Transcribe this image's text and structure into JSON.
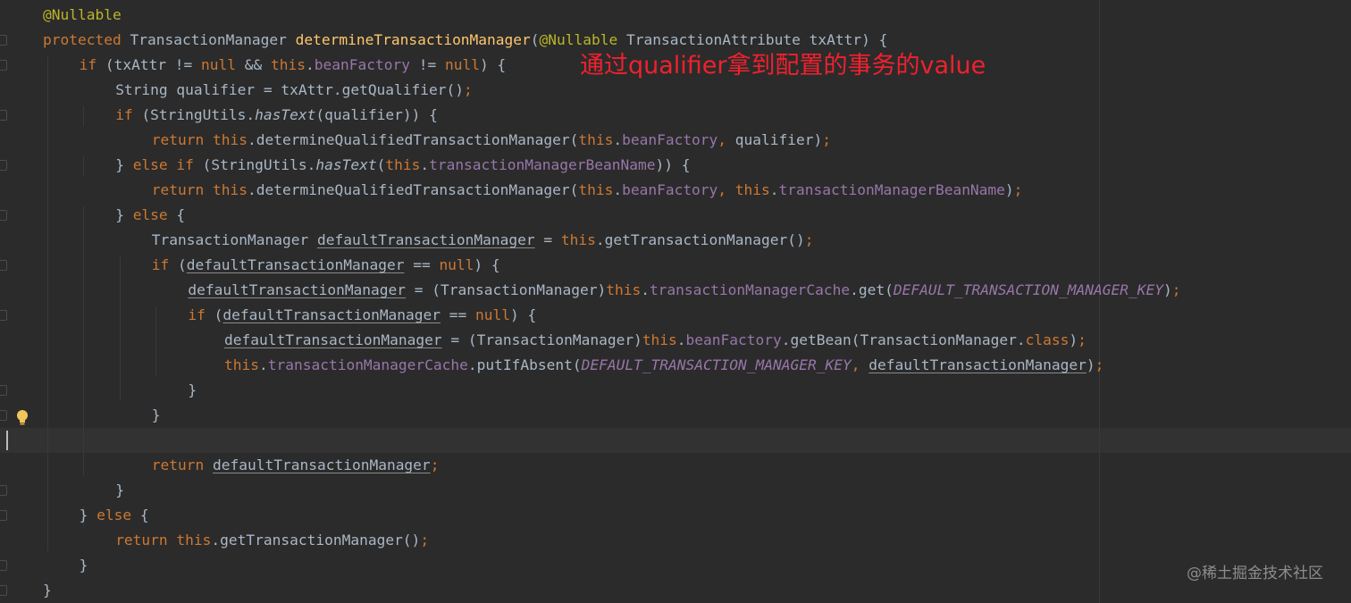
{
  "annotation": "通过qualifier拿到配置的事务的value",
  "watermark": "@稀土掘金技术社区",
  "icons": {
    "intention_bulb": "lightbulb-icon",
    "fold_marker": "fold-marker-icon"
  },
  "colors": {
    "background": "#2b2b2b",
    "keyword": "#cc7832",
    "annotation_tag": "#bbb529",
    "method_declaration": "#ffc66d",
    "field": "#9876aa",
    "default_text": "#a9b7c6",
    "callout": "#f0212e"
  },
  "code": {
    "lines": [
      {
        "indent": 0,
        "tokens": [
          {
            "t": "@Nullable",
            "c": "ann"
          }
        ]
      },
      {
        "indent": 0,
        "tokens": [
          {
            "t": "protected ",
            "c": "kw"
          },
          {
            "t": "TransactionManager "
          },
          {
            "t": "determineTransactionManager",
            "c": "fn"
          },
          {
            "t": "("
          },
          {
            "t": "@Nullable ",
            "c": "ann"
          },
          {
            "t": "TransactionAttribute txAttr) {"
          }
        ]
      },
      {
        "indent": 1,
        "tokens": [
          {
            "t": "if ",
            "c": "kw"
          },
          {
            "t": "(txAttr != "
          },
          {
            "t": "null ",
            "c": "kw"
          },
          {
            "t": "&& "
          },
          {
            "t": "this",
            "c": "kw"
          },
          {
            "t": "."
          },
          {
            "t": "beanFactory",
            "c": "field"
          },
          {
            "t": " != "
          },
          {
            "t": "null",
            "c": "kw"
          },
          {
            "t": ") {"
          }
        ]
      },
      {
        "indent": 2,
        "tokens": [
          {
            "t": "String qualifier = txAttr.getQualifier()"
          },
          {
            "t": ";",
            "c": "kw"
          }
        ]
      },
      {
        "indent": 2,
        "tokens": [
          {
            "t": "if ",
            "c": "kw"
          },
          {
            "t": "(StringUtils."
          },
          {
            "t": "hasText",
            "c": "static"
          },
          {
            "t": "(qualifier)) {"
          }
        ]
      },
      {
        "indent": 3,
        "tokens": [
          {
            "t": "return ",
            "c": "kw"
          },
          {
            "t": "this",
            "c": "kw"
          },
          {
            "t": ".determineQualifiedTransactionManager("
          },
          {
            "t": "this",
            "c": "kw"
          },
          {
            "t": "."
          },
          {
            "t": "beanFactory",
            "c": "field"
          },
          {
            "t": ", ",
            "c": "kw"
          },
          {
            "t": "qualifier)"
          },
          {
            "t": ";",
            "c": "kw"
          }
        ]
      },
      {
        "indent": 2,
        "tokens": [
          {
            "t": "} "
          },
          {
            "t": "else if ",
            "c": "kw"
          },
          {
            "t": "(StringUtils."
          },
          {
            "t": "hasText",
            "c": "static"
          },
          {
            "t": "("
          },
          {
            "t": "this",
            "c": "kw"
          },
          {
            "t": "."
          },
          {
            "t": "transactionManagerBeanName",
            "c": "field"
          },
          {
            "t": ")) {"
          }
        ]
      },
      {
        "indent": 3,
        "tokens": [
          {
            "t": "return ",
            "c": "kw"
          },
          {
            "t": "this",
            "c": "kw"
          },
          {
            "t": ".determineQualifiedTransactionManager("
          },
          {
            "t": "this",
            "c": "kw"
          },
          {
            "t": "."
          },
          {
            "t": "beanFactory",
            "c": "field"
          },
          {
            "t": ", ",
            "c": "kw"
          },
          {
            "t": "this",
            "c": "kw"
          },
          {
            "t": "."
          },
          {
            "t": "transactionManagerBeanName",
            "c": "field"
          },
          {
            "t": ")"
          },
          {
            "t": ";",
            "c": "kw"
          }
        ]
      },
      {
        "indent": 2,
        "tokens": [
          {
            "t": "} "
          },
          {
            "t": "else ",
            "c": "kw"
          },
          {
            "t": "{"
          }
        ]
      },
      {
        "indent": 3,
        "tokens": [
          {
            "t": "TransactionManager "
          },
          {
            "t": "defaultTransactionManager",
            "c": "ul"
          },
          {
            "t": " = "
          },
          {
            "t": "this",
            "c": "kw"
          },
          {
            "t": ".getTransactionManager()"
          },
          {
            "t": ";",
            "c": "kw"
          }
        ]
      },
      {
        "indent": 3,
        "tokens": [
          {
            "t": "if ",
            "c": "kw"
          },
          {
            "t": "("
          },
          {
            "t": "defaultTransactionManager",
            "c": "ul"
          },
          {
            "t": " == "
          },
          {
            "t": "null",
            "c": "kw"
          },
          {
            "t": ") {"
          }
        ]
      },
      {
        "indent": 4,
        "tokens": [
          {
            "t": "defaultTransactionManager",
            "c": "ul"
          },
          {
            "t": " = (TransactionManager)"
          },
          {
            "t": "this",
            "c": "kw"
          },
          {
            "t": "."
          },
          {
            "t": "transactionManagerCache",
            "c": "field"
          },
          {
            "t": ".get("
          },
          {
            "t": "DEFAULT_TRANSACTION_MANAGER_KEY",
            "c": "const"
          },
          {
            "t": ")"
          },
          {
            "t": ";",
            "c": "kw"
          }
        ]
      },
      {
        "indent": 4,
        "tokens": [
          {
            "t": "if ",
            "c": "kw"
          },
          {
            "t": "("
          },
          {
            "t": "defaultTransactionManager",
            "c": "ul"
          },
          {
            "t": " == "
          },
          {
            "t": "null",
            "c": "kw"
          },
          {
            "t": ") {"
          }
        ]
      },
      {
        "indent": 5,
        "tokens": [
          {
            "t": "defaultTransactionManager",
            "c": "ul"
          },
          {
            "t": " = (TransactionManager)"
          },
          {
            "t": "this",
            "c": "kw"
          },
          {
            "t": "."
          },
          {
            "t": "beanFactory",
            "c": "field"
          },
          {
            "t": ".getBean(TransactionManager."
          },
          {
            "t": "class",
            "c": "kw"
          },
          {
            "t": ")"
          },
          {
            "t": ";",
            "c": "kw"
          }
        ]
      },
      {
        "indent": 5,
        "tokens": [
          {
            "t": "this",
            "c": "kw"
          },
          {
            "t": "."
          },
          {
            "t": "transactionManagerCache",
            "c": "field"
          },
          {
            "t": ".putIfAbsent("
          },
          {
            "t": "DEFAULT_TRANSACTION_MANAGER_KEY",
            "c": "const"
          },
          {
            "t": ", ",
            "c": "kw"
          },
          {
            "t": "defaultTransactionManager",
            "c": "ul"
          },
          {
            "t": ")"
          },
          {
            "t": ";",
            "c": "kw"
          }
        ]
      },
      {
        "indent": 4,
        "tokens": [
          {
            "t": "}"
          }
        ]
      },
      {
        "indent": 3,
        "tokens": [
          {
            "t": "}"
          }
        ]
      },
      {
        "indent": 0,
        "tokens": []
      },
      {
        "indent": 3,
        "tokens": [
          {
            "t": "return ",
            "c": "kw"
          },
          {
            "t": "defaultTransactionManager",
            "c": "ul"
          },
          {
            "t": ";",
            "c": "kw"
          }
        ]
      },
      {
        "indent": 2,
        "tokens": [
          {
            "t": "}"
          }
        ]
      },
      {
        "indent": 1,
        "tokens": [
          {
            "t": "} "
          },
          {
            "t": "else ",
            "c": "kw"
          },
          {
            "t": "{"
          }
        ]
      },
      {
        "indent": 2,
        "tokens": [
          {
            "t": "return ",
            "c": "kw"
          },
          {
            "t": "this",
            "c": "kw"
          },
          {
            "t": ".getTransactionManager()"
          },
          {
            "t": ";",
            "c": "kw"
          }
        ]
      },
      {
        "indent": 1,
        "tokens": [
          {
            "t": "}"
          }
        ]
      },
      {
        "indent": 0,
        "tokens": [
          {
            "t": "}"
          }
        ]
      }
    ]
  }
}
